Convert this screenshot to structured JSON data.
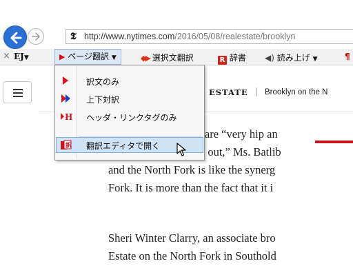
{
  "browser": {
    "url_main": "http://www.nytimes.com",
    "url_rest": "/2016/05/08/realestate/brooklyn"
  },
  "toolbar": {
    "close_glyph": "×",
    "ej_label": "EJ",
    "page_translate_label": "ページ翻訳",
    "selection_translate_label": "選択文翻訳",
    "dictionary_label": "辞書",
    "read_aloud_label": "読み上げ"
  },
  "article": {
    "section": "ESTATE",
    "section_separator": "|",
    "section_subtitle": "Brooklyn on the N",
    "para1": [
      "ptons are “very hip an",
      "from me when we go out,” Ms. Batlib",
      "and the North Fork is like the synerg",
      "Fork. It is more than the fact that it i"
    ],
    "para2": [
      "Sheri Winter Clarry, an associate bro",
      "Estate on the North Fork in Southold"
    ]
  },
  "menu": {
    "items": [
      {
        "label": "訳文のみ",
        "icon": "single-arrow-icon"
      },
      {
        "label": "上下対訳",
        "icon": "double-arrow-icon"
      },
      {
        "label": "ヘッダ・リンクタグのみ",
        "icon": "header-tag-icon"
      },
      {
        "label": "翻訳エディタで開く",
        "icon": "translation-editor-icon"
      }
    ]
  },
  "colors": {
    "accent_red": "#c8141e",
    "back_button_blue": "#2a6fd6",
    "menu_highlight": "#cfe3f7",
    "arrow_blue": "#1a3fd0"
  }
}
